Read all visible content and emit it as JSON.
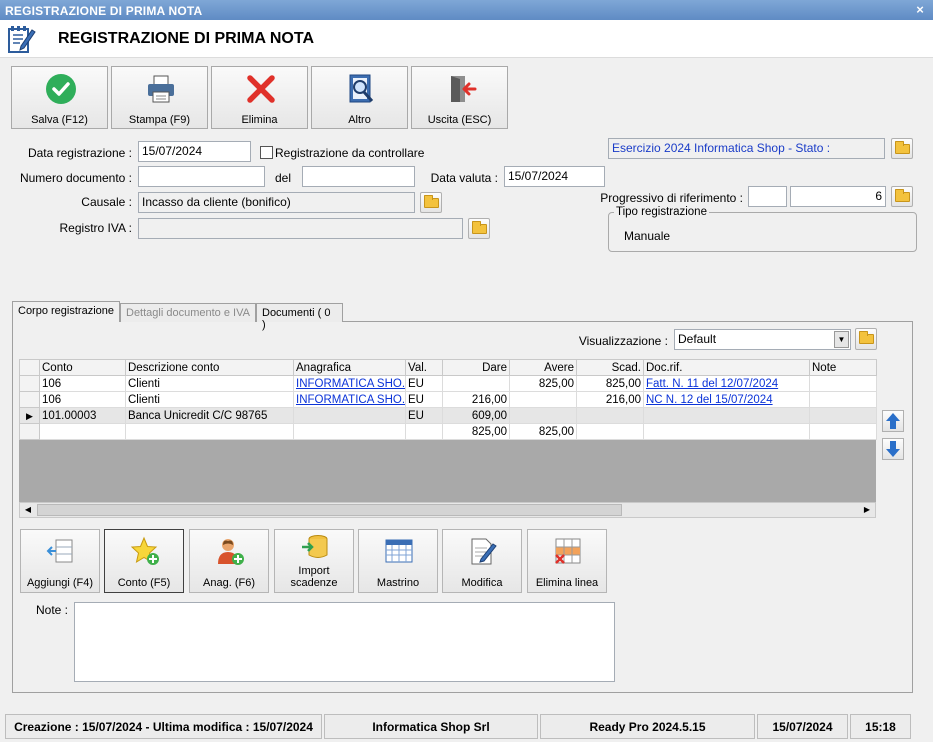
{
  "window": {
    "title": "REGISTRAZIONE DI PRIMA NOTA",
    "close": "×"
  },
  "header": {
    "title": "REGISTRAZIONE DI PRIMA NOTA"
  },
  "toolbar": {
    "salva": "Salva (F12)",
    "stampa": "Stampa (F9)",
    "elimina": "Elimina",
    "altro": "Altro",
    "uscita": "Uscita (ESC)"
  },
  "form": {
    "data_registrazione_label": "Data registrazione :",
    "data_registrazione": "15/07/2024",
    "da_controllare_label": "Registrazione da controllare",
    "numero_documento_label": "Numero documento :",
    "numero_documento": "",
    "del_label": "del",
    "del_value": "",
    "data_valuta_label": "Data valuta :",
    "data_valuta": "15/07/2024",
    "causale_label": "Causale :",
    "causale": "Incasso da cliente (bonifico)",
    "registro_iva_label": "Registro IVA :",
    "registro_iva": "",
    "esercizio": "Esercizio 2024 Informatica Shop - Stato :",
    "progressivo_label": "Progressivo di riferimento :",
    "progressivo_prefix": "",
    "progressivo": "6",
    "tipo_registrazione_label": "Tipo registrazione",
    "tipo_registrazione": "Manuale"
  },
  "tabs": [
    "Corpo registrazione",
    "Dettagli documento e IVA",
    "Documenti ( 0 )"
  ],
  "view": {
    "label": "Visualizzazione :",
    "value": "Default"
  },
  "grid": {
    "columns": [
      "Conto",
      "Descrizione conto",
      "Anagrafica",
      "Val.",
      "Dare",
      "Avere",
      "Scad.",
      "Doc.rif.",
      "Note"
    ],
    "rows": [
      {
        "conto": "106",
        "descr": "Clienti",
        "anag": "INFORMATICA SHO...",
        "val": "EU",
        "dare": "",
        "avere": "825,00",
        "scad": "825,00",
        "docrif": "Fatt. N. 11 del 12/07/2024",
        "note": ""
      },
      {
        "conto": "106",
        "descr": "Clienti",
        "anag": "INFORMATICA SHO...",
        "val": "EU",
        "dare": "216,00",
        "avere": "",
        "scad": "216,00",
        "docrif": "NC N. 12 del 15/07/2024",
        "note": ""
      },
      {
        "conto": "101.00003",
        "descr": "Banca Unicredit C/C 98765",
        "anag": "",
        "val": "EU",
        "dare": "609,00",
        "avere": "",
        "scad": "",
        "docrif": "",
        "note": ""
      }
    ],
    "totals": {
      "dare": "825,00",
      "avere": "825,00"
    }
  },
  "actions": {
    "aggiungi": "Aggiungi (F4)",
    "conto": "Conto (F5)",
    "anag": "Anag. (F6)",
    "import_1": "Import",
    "import_2": "scadenze",
    "mastrino": "Mastrino",
    "modifica": "Modifica",
    "elimina_linea": "Elimina linea"
  },
  "note": {
    "label": "Note :",
    "value": ""
  },
  "status": {
    "creazione": "Creazione : 15/07/2024 - Ultima modifica : 15/07/2024",
    "azienda": "Informatica Shop Srl",
    "versione": "Ready Pro 2024.5.15",
    "data": "15/07/2024",
    "ora": "15:18"
  }
}
